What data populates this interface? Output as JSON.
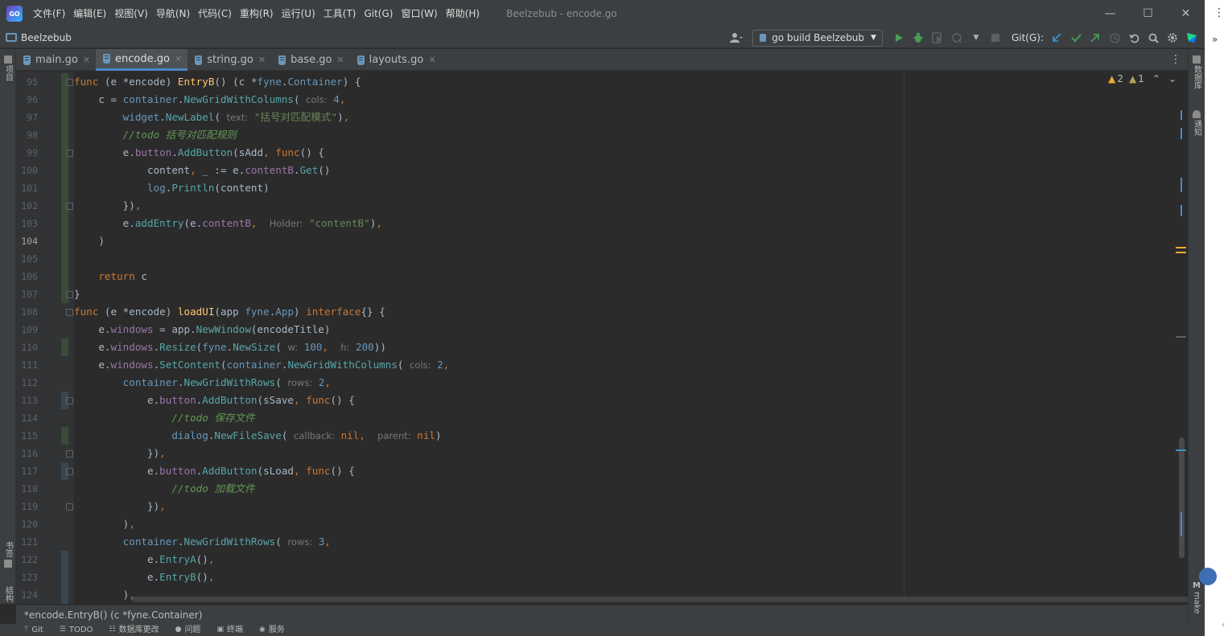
{
  "app": {
    "logo_text": "GO",
    "window_title": "Beelzebub - encode.go",
    "menu": [
      "文件(F)",
      "编辑(E)",
      "视图(V)",
      "导航(N)",
      "代码(C)",
      "重构(R)",
      "运行(U)",
      "工具(T)",
      "Git(G)",
      "窗口(W)",
      "帮助(H)"
    ],
    "win_controls": {
      "minimize": "—",
      "maximize": "☐",
      "close": "✕"
    }
  },
  "navbar": {
    "project": "Beelzebub",
    "run_config": "go build Beelzebub",
    "git_label": "Git(G):"
  },
  "left_strip": {
    "project_tab": "项目",
    "bookmarks_tab": "书签",
    "structure_tab": "结构"
  },
  "right_strip": {
    "database_tab": "数据库",
    "notifications_tab": "通知",
    "make_tab": "make",
    "make_icon_letter": "M"
  },
  "tabs": [
    {
      "label": "main.go",
      "active": false
    },
    {
      "label": "encode.go",
      "active": true
    },
    {
      "label": "string.go",
      "active": false
    },
    {
      "label": "base.go",
      "active": false
    },
    {
      "label": "layouts.go",
      "active": false
    }
  ],
  "inspections": {
    "warnings": "2",
    "weak_warnings": "1"
  },
  "editor": {
    "current_line": 104,
    "line_numbers": [
      "95",
      "96",
      "97",
      "98",
      "99",
      "100",
      "101",
      "102",
      "103",
      "104",
      "105",
      "106",
      "107",
      "108",
      "109",
      "110",
      "111",
      "112",
      "113",
      "114",
      "115",
      "116",
      "117",
      "118",
      "119",
      "120",
      "121",
      "122",
      "123",
      "124"
    ]
  },
  "breadcrumb": "*encode.EntryB() (c *fyne.Container)",
  "bottom_tools": [
    "Git",
    "TODO",
    "数据库更改",
    "问题",
    "终端",
    "服务"
  ],
  "outer": {
    "overflow_icon": "⋮",
    "expand_icon": "»",
    "collapse_icon": "‹"
  },
  "colors": {
    "background": "#2b2b2b",
    "keyword": "#cc7832",
    "function": "#ffc66d",
    "string": "#6a8759",
    "comment": "#629755",
    "accent": "#4a88c7"
  }
}
